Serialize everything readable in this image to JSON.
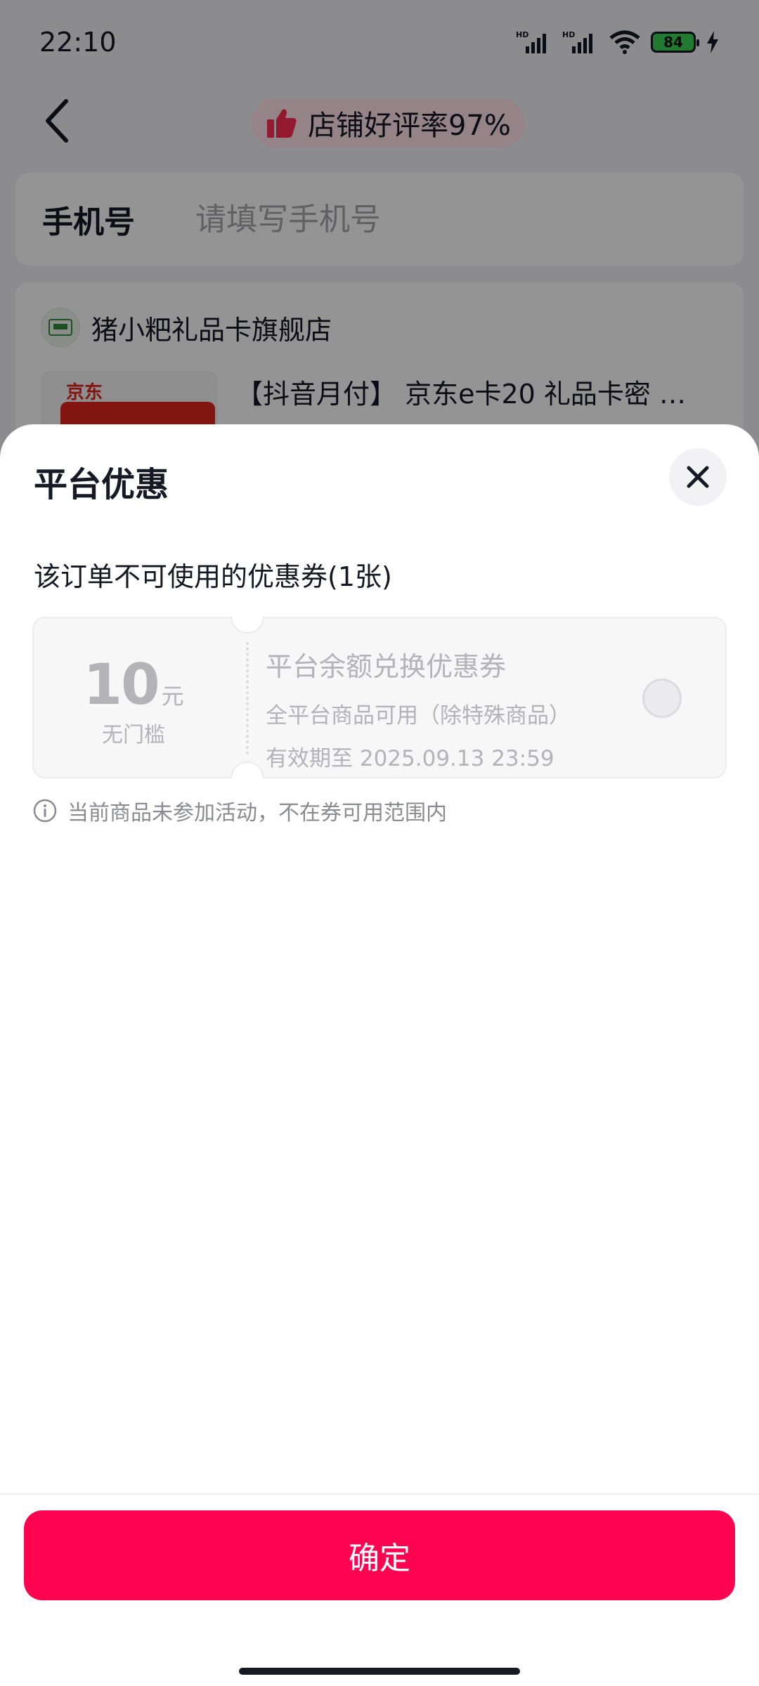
{
  "status_bar": {
    "time": "22:10",
    "battery": "84",
    "icons": [
      "hd-signal-icon",
      "hd-signal-icon",
      "wifi-icon",
      "battery-icon",
      "charging-icon"
    ]
  },
  "nav": {
    "back_icon": "back-arrow-icon",
    "rating_icon": "thumbs-up-icon",
    "rating_text": "店铺好评率97%"
  },
  "phone": {
    "label": "手机号",
    "placeholder": "请填写手机号",
    "value": ""
  },
  "shop": {
    "name": "猪小粑礼品卡旗舰店",
    "product_title": "【抖音月付】 京东e卡20 礼品卡密 …",
    "thumb_brand": "京东"
  },
  "sheet": {
    "title": "平台优惠",
    "close_icon": "close-icon",
    "section_heading": "该订单不可使用的优惠券(1张)",
    "coupon": {
      "amount": "10",
      "unit": "元",
      "threshold": "无门槛",
      "name": "平台余额兑换优惠券",
      "scope": "全平台商品可用（除特殊商品）",
      "expiry": "有效期至 2025.09.13 23:59",
      "selected": false
    },
    "notice_icon": "info-icon",
    "notice": "当前商品未参加活动，不在券可用范围内",
    "confirm_label": "确定",
    "confirm_color": "#fe0350"
  }
}
